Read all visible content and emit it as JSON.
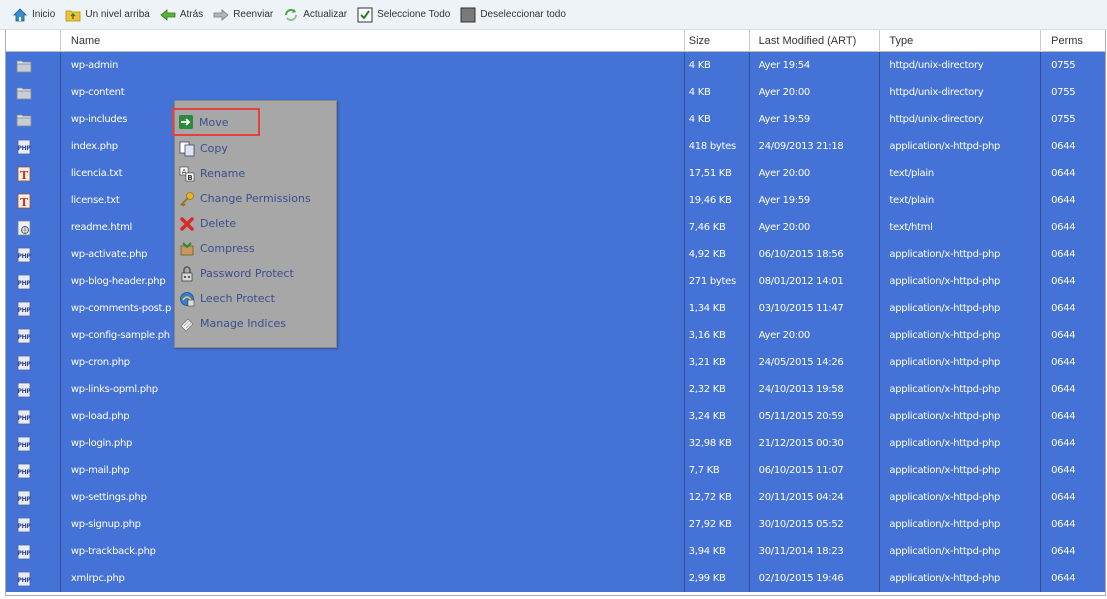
{
  "toolbar": [
    {
      "label": "Inicio",
      "icon": "home-icon"
    },
    {
      "label": "Un nivel arriba",
      "icon": "folder-up-icon"
    },
    {
      "label": "Atrás",
      "icon": "back-arrow-icon"
    },
    {
      "label": "Reenviar",
      "icon": "forward-arrow-icon"
    },
    {
      "label": "Actualizar",
      "icon": "refresh-icon"
    },
    {
      "label": "Seleccione Todo",
      "icon": "checkbox-checked-icon"
    },
    {
      "label": "Deseleccionar todo",
      "icon": "checkbox-unchecked-icon"
    }
  ],
  "columns": {
    "name": "Name",
    "size": "Size",
    "modified": "Last Modified (ART)",
    "type": "Type",
    "perms": "Perms"
  },
  "files": [
    {
      "icon": "folder",
      "name": "wp-admin",
      "size": "4 KB",
      "modified": "Ayer 19:54",
      "type": "httpd/unix-directory",
      "perms": "0755"
    },
    {
      "icon": "folder",
      "name": "wp-content",
      "size": "4 KB",
      "modified": "Ayer 20:00",
      "type": "httpd/unix-directory",
      "perms": "0755"
    },
    {
      "icon": "folder",
      "name": "wp-includes",
      "size": "4 KB",
      "modified": "Ayer 19:59",
      "type": "httpd/unix-directory",
      "perms": "0755"
    },
    {
      "icon": "php",
      "name": "index.php",
      "size": "418 bytes",
      "modified": "24/09/2013 21:18",
      "type": "application/x-httpd-php",
      "perms": "0644"
    },
    {
      "icon": "text",
      "name": "licencia.txt",
      "size": "17,51 KB",
      "modified": "Ayer 20:00",
      "type": "text/plain",
      "perms": "0644"
    },
    {
      "icon": "text",
      "name": "license.txt",
      "size": "19,46 KB",
      "modified": "Ayer 19:59",
      "type": "text/plain",
      "perms": "0644"
    },
    {
      "icon": "html",
      "name": "readme.html",
      "size": "7,46 KB",
      "modified": "Ayer 20:00",
      "type": "text/html",
      "perms": "0644"
    },
    {
      "icon": "php",
      "name": "wp-activate.php",
      "size": "4,92 KB",
      "modified": "06/10/2015 18:56",
      "type": "application/x-httpd-php",
      "perms": "0644"
    },
    {
      "icon": "php",
      "name": "wp-blog-header.php",
      "size": "271 bytes",
      "modified": "08/01/2012 14:01",
      "type": "application/x-httpd-php",
      "perms": "0644"
    },
    {
      "icon": "php",
      "name": "wp-comments-post.p",
      "size": "1,34 KB",
      "modified": "03/10/2015 11:47",
      "type": "application/x-httpd-php",
      "perms": "0644"
    },
    {
      "icon": "php",
      "name": "wp-config-sample.ph",
      "size": "3,16 KB",
      "modified": "Ayer 20:00",
      "type": "application/x-httpd-php",
      "perms": "0644"
    },
    {
      "icon": "php",
      "name": "wp-cron.php",
      "size": "3,21 KB",
      "modified": "24/05/2015 14:26",
      "type": "application/x-httpd-php",
      "perms": "0644"
    },
    {
      "icon": "php",
      "name": "wp-links-opml.php",
      "size": "2,32 KB",
      "modified": "24/10/2013 19:58",
      "type": "application/x-httpd-php",
      "perms": "0644"
    },
    {
      "icon": "php",
      "name": "wp-load.php",
      "size": "3,24 KB",
      "modified": "05/11/2015 20:59",
      "type": "application/x-httpd-php",
      "perms": "0644"
    },
    {
      "icon": "php",
      "name": "wp-login.php",
      "size": "32,98 KB",
      "modified": "21/12/2015 00:30",
      "type": "application/x-httpd-php",
      "perms": "0644"
    },
    {
      "icon": "php",
      "name": "wp-mail.php",
      "size": "7,7 KB",
      "modified": "06/10/2015 11:07",
      "type": "application/x-httpd-php",
      "perms": "0644"
    },
    {
      "icon": "php",
      "name": "wp-settings.php",
      "size": "12,72 KB",
      "modified": "20/11/2015 04:24",
      "type": "application/x-httpd-php",
      "perms": "0644"
    },
    {
      "icon": "php",
      "name": "wp-signup.php",
      "size": "27,92 KB",
      "modified": "30/10/2015 05:52",
      "type": "application/x-httpd-php",
      "perms": "0644"
    },
    {
      "icon": "php",
      "name": "wp-trackback.php",
      "size": "3,94 KB",
      "modified": "30/11/2014 18:23",
      "type": "application/x-httpd-php",
      "perms": "0644"
    },
    {
      "icon": "php",
      "name": "xmlrpc.php",
      "size": "2,99 KB",
      "modified": "02/10/2015 19:46",
      "type": "application/x-httpd-php",
      "perms": "0644"
    }
  ],
  "context_menu": [
    {
      "label": "Move",
      "icon": "move-icon"
    },
    {
      "label": "Copy",
      "icon": "copy-icon"
    },
    {
      "label": "Rename",
      "icon": "rename-icon"
    },
    {
      "label": "Change Permissions",
      "icon": "key-icon"
    },
    {
      "label": "Delete",
      "icon": "delete-icon"
    },
    {
      "label": "Compress",
      "icon": "compress-icon"
    },
    {
      "label": "Password Protect",
      "icon": "lock-icon"
    },
    {
      "label": "Leech Protect",
      "icon": "leech-protect-icon"
    },
    {
      "label": "Manage Indices",
      "icon": "manage-indices-icon"
    }
  ],
  "colors": {
    "selection": "#4472d6",
    "menu_bg": "#a7a7a7",
    "highlight_border": "#e5403a"
  }
}
